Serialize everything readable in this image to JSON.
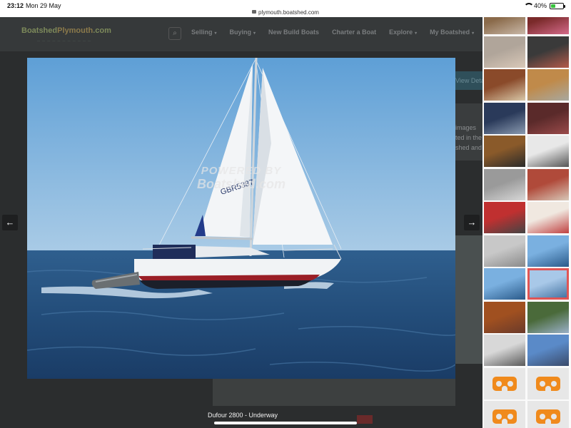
{
  "status": {
    "time": "23:12",
    "date": "Mon 29 May",
    "url": "plymouth.boatshed.com",
    "battery": "40%",
    "battery_level": 0.4
  },
  "site": {
    "logo_main": "Boatshed",
    "logo_city": "Plymouth",
    "logo_tld": ".com",
    "nav": [
      "Selling",
      "Buying",
      "New Build Boats",
      "Charter a Boat",
      "Explore",
      "My Boatshed"
    ],
    "bg_button": "View Details",
    "bg_text_lines": [
      "images",
      "ted in the",
      "shed and"
    ]
  },
  "photo": {
    "watermark_line1": "POWERED BY",
    "watermark_line2": "Boatshed.com",
    "sail_number": "GBR5387",
    "caption": "Dufour 2800 - Underway"
  },
  "nav_buttons": {
    "prev": "←",
    "next": "→"
  },
  "thumbnails": [
    {
      "c1": "#8a6a4a",
      "c2": "#c9b8a8"
    },
    {
      "c1": "#7a2a2a",
      "c2": "#d46a8a"
    },
    {
      "c1": "#b0a59a",
      "c2": "#d9c8b8"
    },
    {
      "c1": "#3a3a3a",
      "c2": "#b45a4a"
    },
    {
      "c1": "#8a4a2a",
      "c2": "#d9c8a8"
    },
    {
      "c1": "#c08a4a",
      "c2": "#a8a8a0"
    },
    {
      "c1": "#2a3a5a",
      "c2": "#8a9ab0"
    },
    {
      "c1": "#5a2a2a",
      "c2": "#9a4a4a"
    },
    {
      "c1": "#8a5a2a",
      "c2": "#2a2a2a"
    },
    {
      "c1": "#e8e8e8",
      "c2": "#555555"
    },
    {
      "c1": "#9a9a9a",
      "c2": "#d8d8d8"
    },
    {
      "c1": "#b04a3a",
      "c2": "#d8c8b8"
    },
    {
      "c1": "#c03030",
      "c2": "#444444"
    },
    {
      "c1": "#f0e8e0",
      "c2": "#c04040"
    },
    {
      "c1": "#c8c8c8",
      "c2": "#8a8a8a"
    },
    {
      "c1": "#7ab0e0",
      "c2": "#2a5a8a"
    },
    {
      "c1": "#7ab0e0",
      "c2": "#2a5a8a"
    },
    {
      "c1": "#a8c8e8",
      "c2": "#3a6a9a"
    },
    {
      "c1": "#a05020",
      "c2": "#6a3a2a"
    },
    {
      "c1": "#4a6a3a",
      "c2": "#9ab0c8"
    },
    {
      "c1": "#d8d8d8",
      "c2": "#5a5a5a"
    },
    {
      "c1": "#5a8ac8",
      "c2": "#3a4a6a"
    }
  ],
  "selected_thumbnail_index": 17,
  "vr_count": 4
}
